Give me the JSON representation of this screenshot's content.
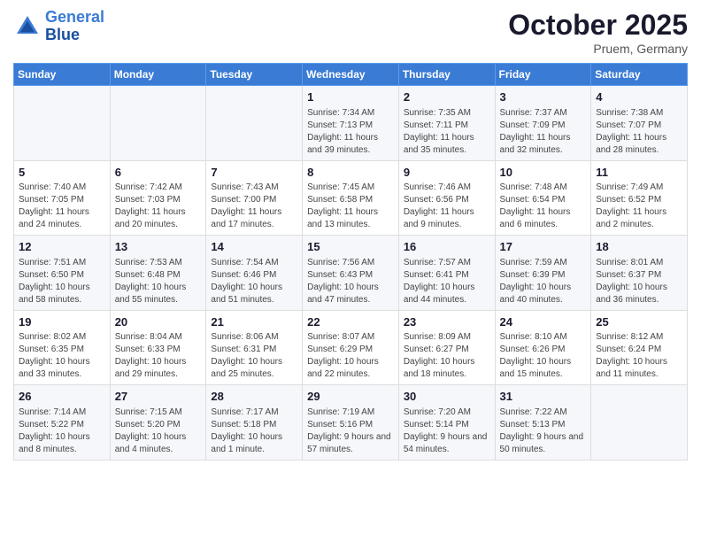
{
  "header": {
    "logo_line1": "General",
    "logo_line2": "Blue",
    "month": "October 2025",
    "location": "Pruem, Germany"
  },
  "weekdays": [
    "Sunday",
    "Monday",
    "Tuesday",
    "Wednesday",
    "Thursday",
    "Friday",
    "Saturday"
  ],
  "weeks": [
    [
      {
        "day": "",
        "info": ""
      },
      {
        "day": "",
        "info": ""
      },
      {
        "day": "",
        "info": ""
      },
      {
        "day": "1",
        "info": "Sunrise: 7:34 AM\nSunset: 7:13 PM\nDaylight: 11 hours\nand 39 minutes."
      },
      {
        "day": "2",
        "info": "Sunrise: 7:35 AM\nSunset: 7:11 PM\nDaylight: 11 hours\nand 35 minutes."
      },
      {
        "day": "3",
        "info": "Sunrise: 7:37 AM\nSunset: 7:09 PM\nDaylight: 11 hours\nand 32 minutes."
      },
      {
        "day": "4",
        "info": "Sunrise: 7:38 AM\nSunset: 7:07 PM\nDaylight: 11 hours\nand 28 minutes."
      }
    ],
    [
      {
        "day": "5",
        "info": "Sunrise: 7:40 AM\nSunset: 7:05 PM\nDaylight: 11 hours\nand 24 minutes."
      },
      {
        "day": "6",
        "info": "Sunrise: 7:42 AM\nSunset: 7:03 PM\nDaylight: 11 hours\nand 20 minutes."
      },
      {
        "day": "7",
        "info": "Sunrise: 7:43 AM\nSunset: 7:00 PM\nDaylight: 11 hours\nand 17 minutes."
      },
      {
        "day": "8",
        "info": "Sunrise: 7:45 AM\nSunset: 6:58 PM\nDaylight: 11 hours\nand 13 minutes."
      },
      {
        "day": "9",
        "info": "Sunrise: 7:46 AM\nSunset: 6:56 PM\nDaylight: 11 hours\nand 9 minutes."
      },
      {
        "day": "10",
        "info": "Sunrise: 7:48 AM\nSunset: 6:54 PM\nDaylight: 11 hours\nand 6 minutes."
      },
      {
        "day": "11",
        "info": "Sunrise: 7:49 AM\nSunset: 6:52 PM\nDaylight: 11 hours\nand 2 minutes."
      }
    ],
    [
      {
        "day": "12",
        "info": "Sunrise: 7:51 AM\nSunset: 6:50 PM\nDaylight: 10 hours\nand 58 minutes."
      },
      {
        "day": "13",
        "info": "Sunrise: 7:53 AM\nSunset: 6:48 PM\nDaylight: 10 hours\nand 55 minutes."
      },
      {
        "day": "14",
        "info": "Sunrise: 7:54 AM\nSunset: 6:46 PM\nDaylight: 10 hours\nand 51 minutes."
      },
      {
        "day": "15",
        "info": "Sunrise: 7:56 AM\nSunset: 6:43 PM\nDaylight: 10 hours\nand 47 minutes."
      },
      {
        "day": "16",
        "info": "Sunrise: 7:57 AM\nSunset: 6:41 PM\nDaylight: 10 hours\nand 44 minutes."
      },
      {
        "day": "17",
        "info": "Sunrise: 7:59 AM\nSunset: 6:39 PM\nDaylight: 10 hours\nand 40 minutes."
      },
      {
        "day": "18",
        "info": "Sunrise: 8:01 AM\nSunset: 6:37 PM\nDaylight: 10 hours\nand 36 minutes."
      }
    ],
    [
      {
        "day": "19",
        "info": "Sunrise: 8:02 AM\nSunset: 6:35 PM\nDaylight: 10 hours\nand 33 minutes."
      },
      {
        "day": "20",
        "info": "Sunrise: 8:04 AM\nSunset: 6:33 PM\nDaylight: 10 hours\nand 29 minutes."
      },
      {
        "day": "21",
        "info": "Sunrise: 8:06 AM\nSunset: 6:31 PM\nDaylight: 10 hours\nand 25 minutes."
      },
      {
        "day": "22",
        "info": "Sunrise: 8:07 AM\nSunset: 6:29 PM\nDaylight: 10 hours\nand 22 minutes."
      },
      {
        "day": "23",
        "info": "Sunrise: 8:09 AM\nSunset: 6:27 PM\nDaylight: 10 hours\nand 18 minutes."
      },
      {
        "day": "24",
        "info": "Sunrise: 8:10 AM\nSunset: 6:26 PM\nDaylight: 10 hours\nand 15 minutes."
      },
      {
        "day": "25",
        "info": "Sunrise: 8:12 AM\nSunset: 6:24 PM\nDaylight: 10 hours\nand 11 minutes."
      }
    ],
    [
      {
        "day": "26",
        "info": "Sunrise: 7:14 AM\nSunset: 5:22 PM\nDaylight: 10 hours\nand 8 minutes."
      },
      {
        "day": "27",
        "info": "Sunrise: 7:15 AM\nSunset: 5:20 PM\nDaylight: 10 hours\nand 4 minutes."
      },
      {
        "day": "28",
        "info": "Sunrise: 7:17 AM\nSunset: 5:18 PM\nDaylight: 10 hours\nand 1 minute."
      },
      {
        "day": "29",
        "info": "Sunrise: 7:19 AM\nSunset: 5:16 PM\nDaylight: 9 hours\nand 57 minutes."
      },
      {
        "day": "30",
        "info": "Sunrise: 7:20 AM\nSunset: 5:14 PM\nDaylight: 9 hours\nand 54 minutes."
      },
      {
        "day": "31",
        "info": "Sunrise: 7:22 AM\nSunset: 5:13 PM\nDaylight: 9 hours\nand 50 minutes."
      },
      {
        "day": "",
        "info": ""
      }
    ]
  ]
}
